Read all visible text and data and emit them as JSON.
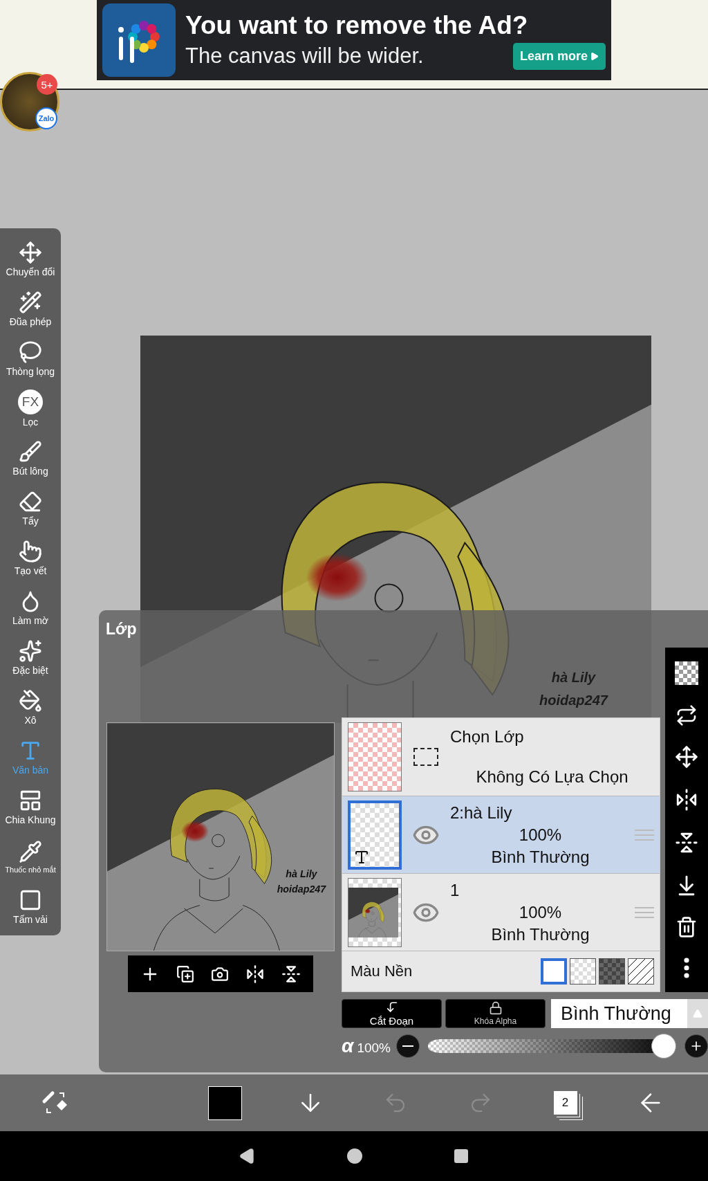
{
  "ad": {
    "title": "You want to remove the Ad?",
    "subtitle": "The canvas will be wider.",
    "button": "Learn more"
  },
  "chat_bubble": {
    "badge": "5+",
    "label": "Zalo"
  },
  "tools": [
    {
      "label": "Chuyển đổi",
      "selected": false
    },
    {
      "label": "Đũa phép",
      "selected": false
    },
    {
      "label": "Thòng lọng",
      "selected": false
    },
    {
      "label": "Lọc",
      "selected": false,
      "icon_text": "FX"
    },
    {
      "label": "Bút lông",
      "selected": false
    },
    {
      "label": "Tẩy",
      "selected": false
    },
    {
      "label": "Tạo vết",
      "selected": false
    },
    {
      "label": "Làm mờ",
      "selected": false
    },
    {
      "label": "Đặc biệt",
      "selected": false
    },
    {
      "label": "Xô",
      "selected": false
    },
    {
      "label": "Văn bản",
      "selected": true
    },
    {
      "label": "Chia Khung",
      "selected": false
    },
    {
      "label": "Thuốc nhỏ mắt",
      "selected": false
    },
    {
      "label": "Tấm vải",
      "selected": false
    }
  ],
  "canvas": {
    "texts": [
      "hà Lily",
      "hoidap247"
    ]
  },
  "layers_panel": {
    "title": "Lớp",
    "preview": {
      "texts": [
        "hà Lily",
        "hoidap247"
      ]
    },
    "selection_layer": {
      "name": "Chọn Lớp",
      "status": "Không Có Lựa Chọn"
    },
    "layers": [
      {
        "name": "2:hà Lily",
        "opacity": "100%",
        "blend": "Bình Thường",
        "selected": true,
        "visible": true,
        "kind": "text"
      },
      {
        "name": "1",
        "opacity": "100%",
        "blend": "Bình Thường",
        "selected": false,
        "visible": true,
        "kind": "image"
      }
    ],
    "background": {
      "label": "Màu Nền",
      "options": [
        {
          "kind": "white",
          "selected": true
        },
        {
          "kind": "checker",
          "selected": false
        },
        {
          "kind": "dark",
          "selected": false
        },
        {
          "kind": "none",
          "selected": false
        }
      ]
    },
    "buttons": [
      "Cắt Đoạn",
      "Khóa Alpha"
    ],
    "blend_mode": "Bình Thường",
    "opacity": {
      "symbol": "α",
      "reading": "100%",
      "level": 1
    }
  },
  "bottom_toolbar": {
    "layer_count": "2",
    "undo": {
      "disabled": true
    },
    "redo": {
      "disabled": true
    }
  }
}
